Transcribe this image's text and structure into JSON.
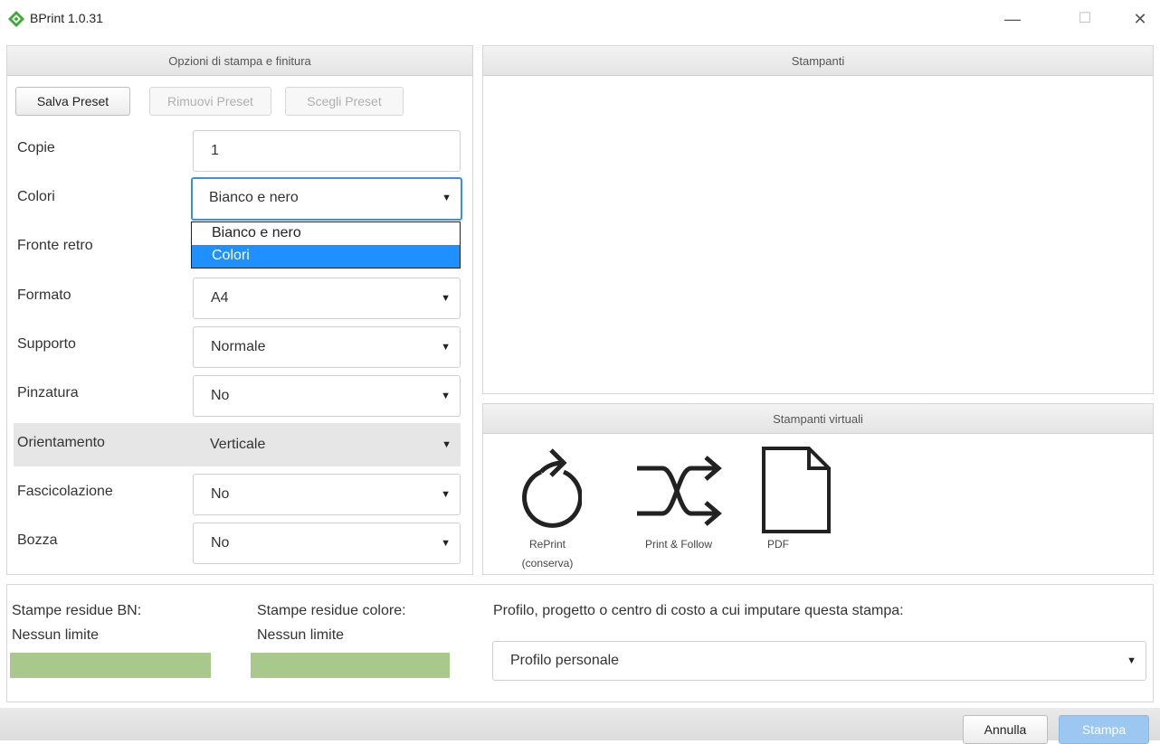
{
  "window": {
    "title": "BPrint 1.0.31",
    "controls": [
      "—",
      "☐",
      "✕"
    ]
  },
  "left_panel": {
    "header": "Opzioni di stampa e finitura",
    "buttons": {
      "save": "Salva Preset",
      "remove": "Rimuovi Preset",
      "choose": "Scegli Preset"
    },
    "fields": [
      {
        "label": "Copie",
        "value": "1"
      },
      {
        "label": "Colori",
        "value": "Bianco e nero"
      },
      {
        "label": "Fronte retro",
        "value": ""
      },
      {
        "label": "Formato",
        "value": "A4"
      },
      {
        "label": "Supporto",
        "value": "Normale"
      },
      {
        "label": "Pinzatura",
        "value": "No"
      },
      {
        "label": "Orientamento",
        "value": "Verticale"
      },
      {
        "label": "Fascicolazione",
        "value": "No"
      },
      {
        "label": "Bozza",
        "value": "No"
      }
    ],
    "colori_dropdown": {
      "options": [
        "Bianco e nero",
        "Colori"
      ],
      "highlighted": "Colori"
    }
  },
  "printers_panel": {
    "header": "Stampanti"
  },
  "virtual_panel": {
    "header": "Stampanti virtuali",
    "items": [
      {
        "label": "RePrint",
        "sublabel": "(conserva)",
        "icon": "reprint-icon"
      },
      {
        "label": "Print & Follow",
        "icon": "shuffle-icon"
      },
      {
        "label": "PDF",
        "icon": "document-icon"
      }
    ]
  },
  "quota": {
    "bn_label": "Stampe residue BN:",
    "bn_value": "Nessun limite",
    "color_label": "Stampe residue colore:",
    "color_value": "Nessun limite",
    "bar_color": "#a9c98c"
  },
  "profile": {
    "label": "Profilo, progetto o centro di costo a cui imputare questa stampa:",
    "value": "Profilo personale"
  },
  "footer": {
    "cancel": "Annulla",
    "print": "Stampa"
  },
  "colors": {
    "accent": "#1e90ff",
    "focus": "#3d8fe6",
    "print_button": "#9cc7f0"
  }
}
